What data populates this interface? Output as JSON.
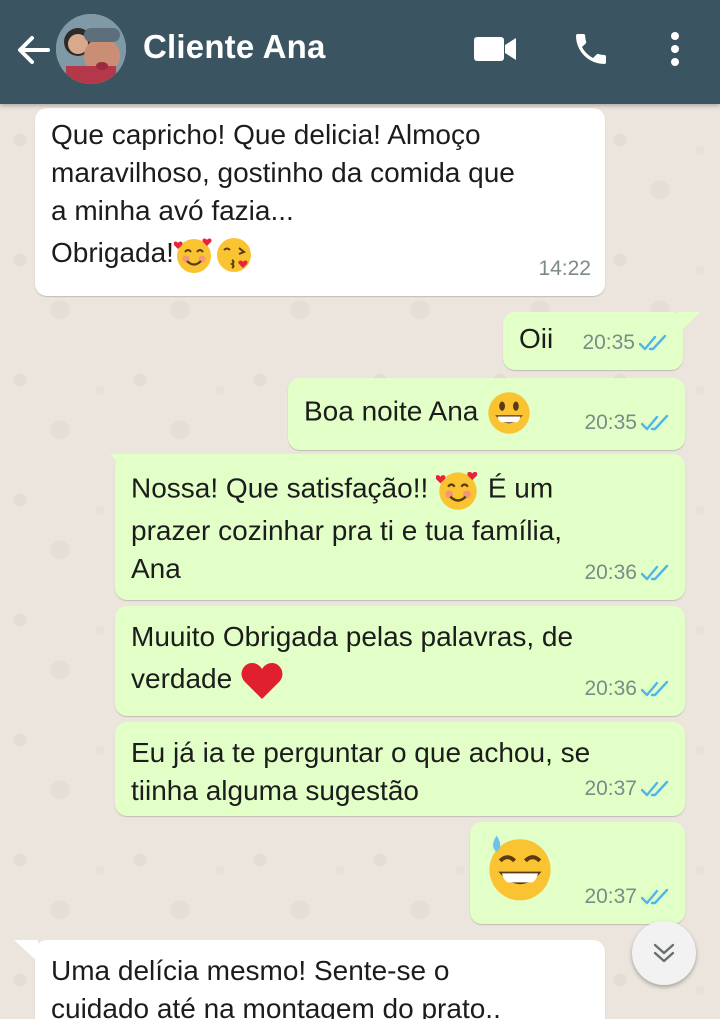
{
  "header": {
    "title": "Cliente Ana"
  },
  "messages": [
    {
      "direction": "in",
      "lines": [
        "Que capricho! Que delicia! Almoço",
        "maravilhoso, gostinho da comida que",
        "a minha avó fazia...",
        "Obrigada!"
      ],
      "time": "14:22"
    },
    {
      "direction": "out",
      "lines": [
        "Oii"
      ],
      "time": "20:35",
      "status": "read"
    },
    {
      "direction": "out",
      "lines": [
        "Boa noite Ana"
      ],
      "time": "20:35",
      "status": "read"
    },
    {
      "direction": "out",
      "lines": [
        "Nossa! Que satisfação!! ",
        "É um",
        "prazer cozinhar pra ti e tua família,",
        "Ana"
      ],
      "time": "20:36",
      "status": "read"
    },
    {
      "direction": "out",
      "lines": [
        "Muuito Obrigada pelas palavras, de",
        "verdade"
      ],
      "time": "20:36",
      "status": "read"
    },
    {
      "direction": "out",
      "lines": [
        "Eu já ia te perguntar o que achou, se",
        "tiinha alguma sugestão"
      ],
      "time": "20:37",
      "status": "read"
    },
    {
      "direction": "out",
      "lines": [],
      "time": "20:37",
      "status": "read"
    },
    {
      "direction": "in",
      "lines": [
        "Uma delícia mesmo! Sente-se o",
        "cuidado até na montagem do prato.."
      ]
    }
  ],
  "colors": {
    "appbar": "#3b5461",
    "outgoing_bubble": "#e1ffc7",
    "incoming_bubble": "#ffffff",
    "read_ticks": "#4fb6ec",
    "wallpaper": "#ece5dd"
  },
  "icons": {
    "back": "arrow-left-icon",
    "video": "video-camera-icon",
    "call": "phone-icon",
    "menu": "more-vertical-icon",
    "scroll": "chevron-double-down-icon",
    "read": "double-check-icon"
  }
}
